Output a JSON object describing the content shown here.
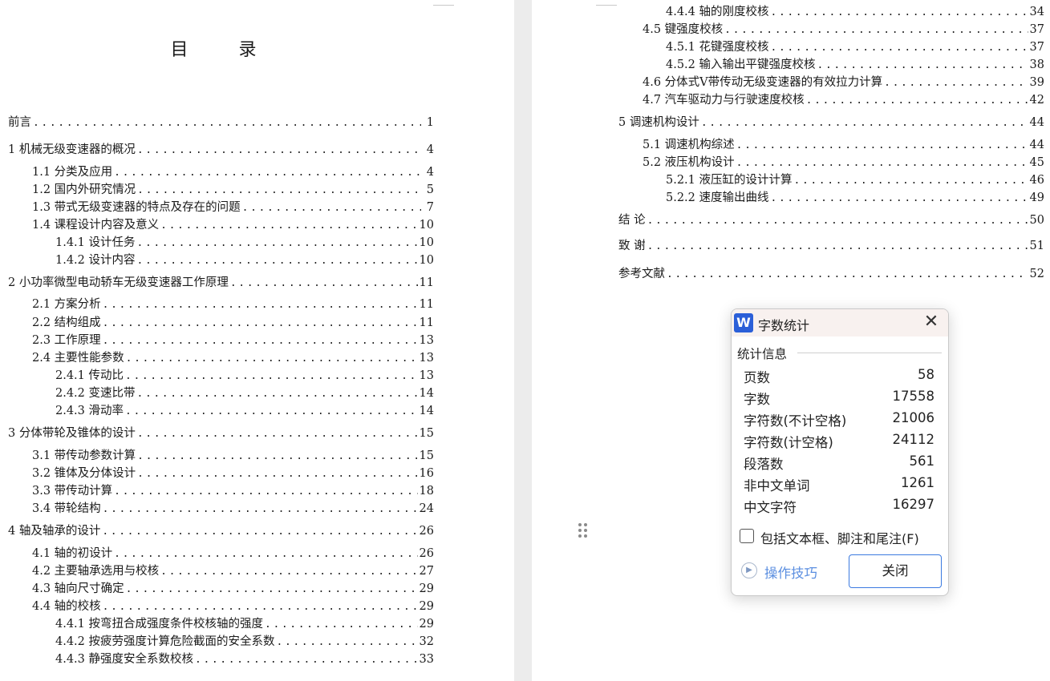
{
  "left_page": {
    "title": "目 录",
    "entries": [
      {
        "text": "前言",
        "page": "1"
      },
      {
        "text": "1 机械无级变速器的概况",
        "page": "4"
      },
      {
        "text": "1.1 分类及应用",
        "page": "4"
      },
      {
        "text": "1.2 国内外研究情况",
        "page": "5"
      },
      {
        "text": "1.3 带式无级变速器的特点及存在的问题",
        "page": "7"
      },
      {
        "text": "1.4 课程设计内容及意义",
        "page": "10"
      },
      {
        "text": "1.4.1 设计任务",
        "page": "10"
      },
      {
        "text": "1.4.2 设计内容",
        "page": "10"
      },
      {
        "text": "2 小功率微型电动轿车无级变速器工作原理",
        "page": "11"
      },
      {
        "text": "2.1 方案分析",
        "page": "11"
      },
      {
        "text": "2.2 结构组成",
        "page": "11"
      },
      {
        "text": "2.3 工作原理",
        "page": "13"
      },
      {
        "text": "2.4 主要性能参数",
        "page": "13"
      },
      {
        "text": "2.4.1 传动比",
        "page": "13"
      },
      {
        "text": "2.4.2 变速比带",
        "page": "14"
      },
      {
        "text": "2.4.3 滑动率",
        "page": "14"
      },
      {
        "text": "3 分体带轮及锥体的设计",
        "page": "15"
      },
      {
        "text": "3.1 带传动参数计算",
        "page": "15"
      },
      {
        "text": "3.2 锥体及分体设计",
        "page": "16"
      },
      {
        "text": "3.3 带传动计算",
        "page": "18"
      },
      {
        "text": "3.4 带轮结构",
        "page": "24"
      },
      {
        "text": "4 轴及轴承的设计",
        "page": "26"
      },
      {
        "text": "4.1 轴的初设计",
        "page": "26"
      },
      {
        "text": "4.2 主要轴承选用与校核",
        "page": "27"
      },
      {
        "text": "4.3 轴向尺寸确定",
        "page": "29"
      },
      {
        "text": "4.4 轴的校核",
        "page": "29"
      },
      {
        "text": "4.4.1 按弯扭合成强度条件校核轴的强度",
        "page": "29"
      },
      {
        "text": "4.4.2 按疲劳强度计算危险截面的安全系数",
        "page": "32"
      },
      {
        "text": "4.4.3 静强度安全系数校核",
        "page": "33"
      }
    ]
  },
  "right_page": {
    "entries": [
      {
        "text": "4.4.4 轴的刚度校核",
        "page": "34"
      },
      {
        "text": "4.5 键强度校核",
        "page": "37"
      },
      {
        "text": "4.5.1 花键强度校核",
        "page": "37"
      },
      {
        "text": "4.5.2 输入输出平键强度校核",
        "page": "38"
      },
      {
        "text": "4.6 分体式V带传动无级变速器的有效拉力计算",
        "page": "39"
      },
      {
        "text": "4.7 汽车驱动力与行驶速度校核",
        "page": "42"
      },
      {
        "text": "5 调速机构设计",
        "page": "44"
      },
      {
        "text": "5.1 调速机构综述",
        "page": "44"
      },
      {
        "text": "5.2 液压机构设计",
        "page": "45"
      },
      {
        "text": "5.2.1 液压缸的设计计算",
        "page": "46"
      },
      {
        "text": "5.2.2 速度输出曲线",
        "page": "49"
      },
      {
        "text": "结 论",
        "page": "50"
      },
      {
        "text": "致 谢",
        "page": "51"
      },
      {
        "text": "参考文献",
        "page": "52"
      }
    ]
  },
  "dialog": {
    "logo": "W",
    "title": "字数统计",
    "close_glyph": "✕",
    "section": "统计信息",
    "stats": [
      {
        "label": "页数",
        "value": "58"
      },
      {
        "label": "字数",
        "value": "17558"
      },
      {
        "label": "字符数(不计空格)",
        "value": "21006"
      },
      {
        "label": "字符数(计空格)",
        "value": "24112"
      },
      {
        "label": "段落数",
        "value": "561"
      },
      {
        "label": "非中文单词",
        "value": "1261"
      },
      {
        "label": "中文字符",
        "value": "16297"
      }
    ],
    "checkbox_label": "包括文本框、脚注和尾注(F)",
    "checkbox_checked": false,
    "tips_label": "操作技巧",
    "close_button": "关闭"
  }
}
